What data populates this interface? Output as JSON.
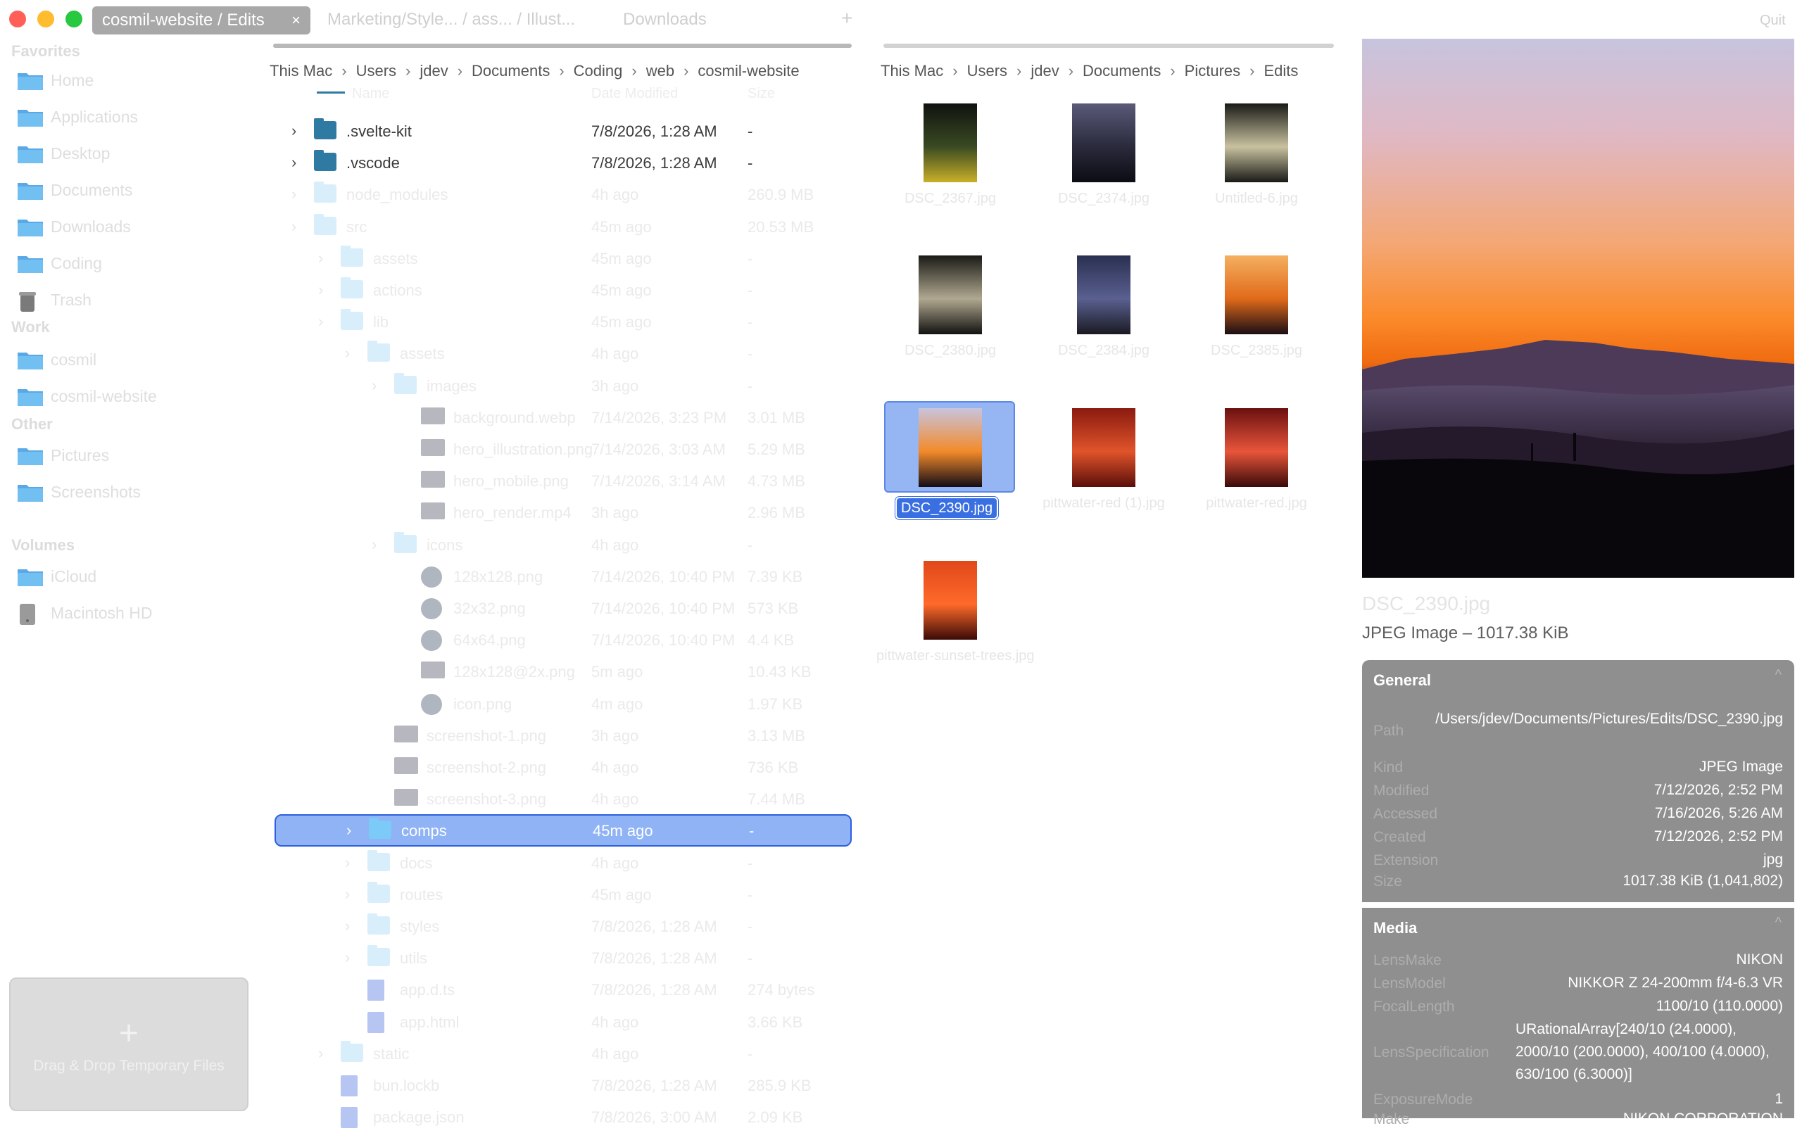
{
  "window": {
    "active_tab": "cosmil-website / Edits",
    "tab_close": "×",
    "tab2": "Marketing/Style... / ass... / Illust...",
    "tab3": "Downloads",
    "plus": "+",
    "top_right": "Quit"
  },
  "sidebar": {
    "favorites_title": "Favorites",
    "work_title": "Work",
    "other_title": "Other",
    "volumes_title": "Volumes",
    "favorites": [
      {
        "label": "Home",
        "icon": "home-folder-icon"
      },
      {
        "label": "Applications",
        "icon": "applications-folder-icon"
      },
      {
        "label": "Desktop",
        "icon": "desktop-folder-icon"
      },
      {
        "label": "Documents",
        "icon": "documents-folder-icon"
      },
      {
        "label": "Downloads",
        "icon": "downloads-folder-icon"
      },
      {
        "label": "Coding",
        "icon": "folder-icon"
      },
      {
        "label": "Trash",
        "icon": "trash-icon"
      }
    ],
    "work": [
      {
        "label": "cosmil",
        "icon": "folder-icon"
      },
      {
        "label": "cosmil-website",
        "icon": "folder-icon"
      }
    ],
    "other": [
      {
        "label": "Pictures",
        "icon": "folder-icon"
      },
      {
        "label": "Screenshots",
        "icon": "folder-icon"
      }
    ],
    "volumes": [
      {
        "label": "iCloud",
        "icon": "folder-icon"
      },
      {
        "label": "Macintosh HD",
        "icon": "disk-icon"
      }
    ],
    "dropzone_plus": "+",
    "dropzone_label": "Drag & Drop Temporary Files"
  },
  "left_pane": {
    "breadcrumb": [
      "This Mac",
      "Users",
      "jdev",
      "Documents",
      "Coding",
      "web",
      "cosmil-website"
    ],
    "column_headers": {
      "name": "Name",
      "date": "Date Modified",
      "size": "Size"
    },
    "rows": [
      {
        "name": ".svelte-kit",
        "date": "7/8/2026, 1:28 AM",
        "size": "-"
      },
      {
        "name": ".vscode",
        "date": "7/8/2026, 1:28 AM",
        "size": "-"
      },
      {
        "name": "node_modules",
        "date": "4h ago",
        "size": "260.9 MB"
      },
      {
        "name": "src",
        "date": "45m ago",
        "size": "20.53 MB"
      },
      {
        "name": "assets",
        "date": "45m ago",
        "size": "-"
      },
      {
        "name": "actions",
        "date": "45m ago",
        "size": "-"
      },
      {
        "name": "lib",
        "date": "45m ago",
        "size": "-"
      },
      {
        "name": "assets",
        "date": "4h ago",
        "size": "-"
      },
      {
        "name": "images",
        "date": "3h ago",
        "size": "-"
      },
      {
        "name": "background.webp",
        "date": "7/14/2026, 3:23 PM",
        "size": "3.01 MB"
      },
      {
        "name": "hero_illustration.png",
        "date": "7/14/2026, 3:03 AM",
        "size": "5.29 MB"
      },
      {
        "name": "hero_mobile.png",
        "date": "7/14/2026, 3:14 AM",
        "size": "4.73 MB"
      },
      {
        "name": "hero_render.mp4",
        "date": "3h ago",
        "size": "2.96 MB"
      },
      {
        "name": "icons",
        "date": "4h ago",
        "size": "-"
      },
      {
        "name": "128x128.png",
        "date": "7/14/2026, 10:40 PM",
        "size": "7.39 KB"
      },
      {
        "name": "32x32.png",
        "date": "7/14/2026, 10:40 PM",
        "size": "573 KB"
      },
      {
        "name": "64x64.png",
        "date": "7/14/2026, 10:40 PM",
        "size": "4.4 KB"
      },
      {
        "name": "128x128@2x.png",
        "date": "5m ago",
        "size": "10.43 KB"
      },
      {
        "name": "icon.png",
        "date": "4m ago",
        "size": "1.97 KB"
      },
      {
        "name": "screenshot-1.png",
        "date": "3h ago",
        "size": "3.13 MB"
      },
      {
        "name": "screenshot-2.png",
        "date": "4h ago",
        "size": "736 KB"
      },
      {
        "name": "screenshot-3.png",
        "date": "4h ago",
        "size": "7.44 MB"
      },
      {
        "name": "comps",
        "date": "45m ago",
        "size": "-"
      },
      {
        "name": "docs",
        "date": "4h ago",
        "size": "-"
      },
      {
        "name": "routes",
        "date": "45m ago",
        "size": "-"
      },
      {
        "name": "styles",
        "date": "7/8/2026, 1:28 AM",
        "size": "-"
      },
      {
        "name": "utils",
        "date": "7/8/2026, 1:28 AM",
        "size": "-"
      },
      {
        "name": "app.d.ts",
        "date": "7/8/2026, 1:28 AM",
        "size": "274 bytes"
      },
      {
        "name": "app.html",
        "date": "4h ago",
        "size": "3.66 KB"
      },
      {
        "name": "static",
        "date": "4h ago",
        "size": "-"
      },
      {
        "name": "bun.lockb",
        "date": "7/8/2026, 1:28 AM",
        "size": "285.9 KB"
      },
      {
        "name": "package.json",
        "date": "7/8/2026, 3:00 AM",
        "size": "2.09 KB"
      }
    ]
  },
  "right_pane": {
    "breadcrumb": [
      "This Mac",
      "Users",
      "jdev",
      "Documents",
      "Pictures",
      "Edits"
    ],
    "thumbnails": [
      {
        "caption": "DSC_2367.jpg"
      },
      {
        "caption": "DSC_2374.jpg"
      },
      {
        "caption": "Untitled-6.jpg"
      },
      {
        "caption": "DSC_2380.jpg"
      },
      {
        "caption": "DSC_2384.jpg"
      },
      {
        "caption": "DSC_2385.jpg"
      },
      {
        "caption": "DSC_2390.jpg"
      },
      {
        "caption": "pittwater-red (1).jpg"
      },
      {
        "caption": "pittwater-red.jpg"
      },
      {
        "caption": "pittwater-sunset-trees.jpg"
      }
    ]
  },
  "preview": {
    "filename": "DSC_2390.jpg",
    "subtitle": "JPEG Image – 1017.38 KiB",
    "general_title": "General",
    "general": [
      {
        "k": "Path",
        "v": "/Users/jdev/Documents/Pictures/Edits/DSC_2390.jpg"
      },
      {
        "k": "Kind",
        "v": "JPEG Image"
      },
      {
        "k": "Modified",
        "v": "7/12/2026, 2:52 PM"
      },
      {
        "k": "Accessed",
        "v": "7/16/2026, 5:26 AM"
      },
      {
        "k": "Created",
        "v": "7/12/2026, 2:52 PM"
      },
      {
        "k": "Extension",
        "v": "jpg"
      },
      {
        "k": "Size",
        "v": "1017.38 KiB (1,041,802)"
      }
    ],
    "media_title": "Media",
    "media": [
      {
        "k": "LensMake",
        "v": "NIKON"
      },
      {
        "k": "LensModel",
        "v": "NIKKOR Z 24-200mm f/4-6.3 VR"
      },
      {
        "k": "FocalLength",
        "v": "1100/10 (110.0000)"
      },
      {
        "k": "LensSpecification",
        "v": "URationalArray[240/10 (24.0000), 2000/10 (200.0000), 400/100 (4.0000), 630/100 (6.3000)]"
      },
      {
        "k": "ExposureMode",
        "v": "1"
      },
      {
        "k": "Make",
        "v": "NIKON CORPORATION"
      }
    ],
    "chevron": "^"
  }
}
